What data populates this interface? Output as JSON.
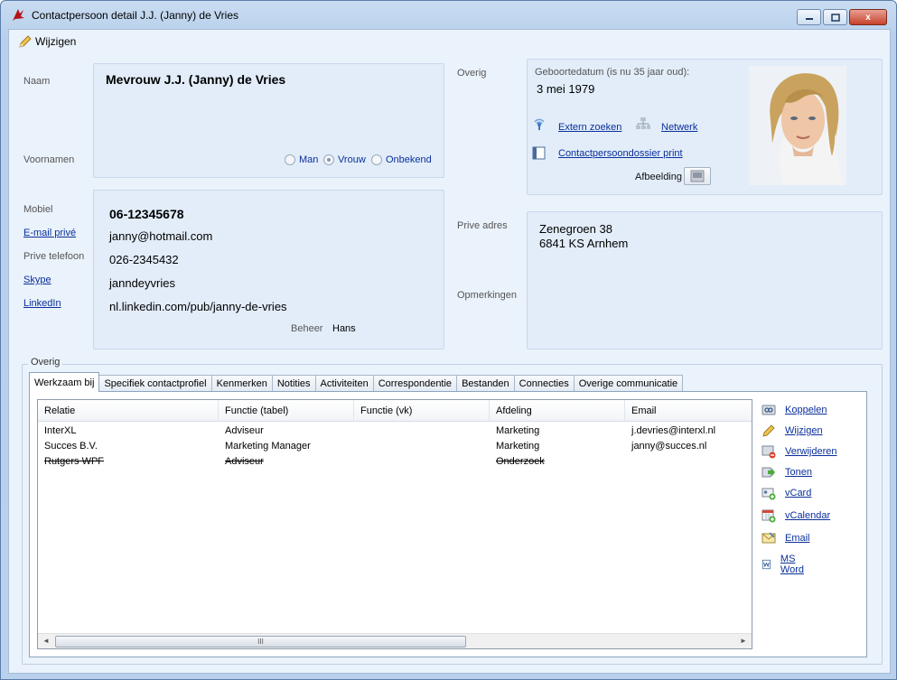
{
  "window": {
    "title": "Contactpersoon detail J.J. (Janny) de Vries",
    "close_glyph": "x"
  },
  "menu": {
    "edit_label": "Wijzigen"
  },
  "person": {
    "name_label": "Naam",
    "name_value": "Mevrouw J.J. (Janny) de Vries",
    "firstnames_label": "Voornamen",
    "gender_options": [
      "Man",
      "Vrouw",
      "Onbekend"
    ],
    "gender_selected": "Vrouw"
  },
  "overig_top": {
    "label": "Overig",
    "birth_label": "Geboortedatum (is nu 35 jaar oud):",
    "birth_value": "3 mei 1979",
    "extern_zoeken": "Extern zoeken",
    "netwerk": "Netwerk",
    "print_link": "Contactpersoondossier print",
    "afbeelding_label": "Afbeelding"
  },
  "contact": {
    "mobiel_label": "Mobiel",
    "mobiel_value": "06-12345678",
    "email_label": "E-mail privé",
    "email_value": "janny@hotmail.com",
    "telefoon_label": "Prive telefoon",
    "telefoon_value": "026-2345432",
    "skype_label": "Skype",
    "skype_value": "janndeyvries",
    "linkedin_label": "LinkedIn",
    "linkedin_value": "nl.linkedin.com/pub/janny-de-vries",
    "beheer_label": "Beheer",
    "beheer_value": "Hans"
  },
  "address": {
    "label": "Prive adres",
    "line1": "Zenegroen 38",
    "line2": "6841 KS  Arnhem",
    "remarks_label": "Opmerkingen"
  },
  "group": {
    "title": "Overig"
  },
  "tabs": [
    "Werkzaam bij",
    "Specifiek contactprofiel",
    "Kenmerken",
    "Notities",
    "Activiteiten",
    "Correspondentie",
    "Bestanden",
    "Connecties",
    "Overige communicatie"
  ],
  "active_tab": "Werkzaam bij",
  "grid": {
    "columns": [
      "Relatie",
      "Functie (tabel)",
      "Functie (vk)",
      "Afdeling",
      "Email"
    ],
    "rows": [
      {
        "relatie": "InterXL",
        "functie_tabel": "Adviseur",
        "functie_vk": "",
        "afdeling": "Marketing",
        "email": "j.devries@interxl.nl",
        "struck": false
      },
      {
        "relatie": "Succes B.V.",
        "functie_tabel": "Marketing Manager",
        "functie_vk": "",
        "afdeling": "Marketing",
        "email": "janny@succes.nl",
        "struck": false
      },
      {
        "relatie": "Rutgers WPF",
        "functie_tabel": "Adviseur",
        "functie_vk": "",
        "afdeling": "Onderzoek",
        "email": "",
        "struck": true
      }
    ],
    "scroll_left": "◄",
    "scroll_right": "►",
    "scroll_grip": "III"
  },
  "actions": [
    {
      "label": "Koppelen",
      "icon": "link-icon"
    },
    {
      "label": "Wijzigen",
      "icon": "edit-icon"
    },
    {
      "label": "Verwijderen",
      "icon": "delete-icon"
    },
    {
      "label": "Tonen",
      "icon": "arrow-right-icon"
    },
    {
      "label": "vCard",
      "icon": "vcard-icon"
    },
    {
      "label": "vCalendar",
      "icon": "calendar-icon"
    },
    {
      "label": "Email",
      "icon": "email-icon"
    },
    {
      "label": "MS Word",
      "icon": "word-icon"
    }
  ]
}
